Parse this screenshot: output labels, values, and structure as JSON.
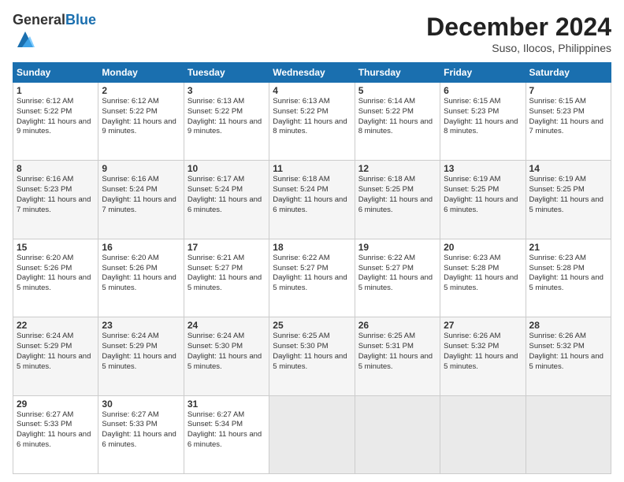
{
  "header": {
    "logo_general": "General",
    "logo_blue": "Blue",
    "month_title": "December 2024",
    "location": "Suso, Ilocos, Philippines"
  },
  "weekdays": [
    "Sunday",
    "Monday",
    "Tuesday",
    "Wednesday",
    "Thursday",
    "Friday",
    "Saturday"
  ],
  "weeks": [
    [
      {
        "day": "1",
        "sunrise": "6:12 AM",
        "sunset": "5:22 PM",
        "daylight": "11 hours and 9 minutes."
      },
      {
        "day": "2",
        "sunrise": "6:12 AM",
        "sunset": "5:22 PM",
        "daylight": "11 hours and 9 minutes."
      },
      {
        "day": "3",
        "sunrise": "6:13 AM",
        "sunset": "5:22 PM",
        "daylight": "11 hours and 9 minutes."
      },
      {
        "day": "4",
        "sunrise": "6:13 AM",
        "sunset": "5:22 PM",
        "daylight": "11 hours and 8 minutes."
      },
      {
        "day": "5",
        "sunrise": "6:14 AM",
        "sunset": "5:22 PM",
        "daylight": "11 hours and 8 minutes."
      },
      {
        "day": "6",
        "sunrise": "6:15 AM",
        "sunset": "5:23 PM",
        "daylight": "11 hours and 8 minutes."
      },
      {
        "day": "7",
        "sunrise": "6:15 AM",
        "sunset": "5:23 PM",
        "daylight": "11 hours and 7 minutes."
      }
    ],
    [
      {
        "day": "8",
        "sunrise": "6:16 AM",
        "sunset": "5:23 PM",
        "daylight": "11 hours and 7 minutes."
      },
      {
        "day": "9",
        "sunrise": "6:16 AM",
        "sunset": "5:24 PM",
        "daylight": "11 hours and 7 minutes."
      },
      {
        "day": "10",
        "sunrise": "6:17 AM",
        "sunset": "5:24 PM",
        "daylight": "11 hours and 6 minutes."
      },
      {
        "day": "11",
        "sunrise": "6:18 AM",
        "sunset": "5:24 PM",
        "daylight": "11 hours and 6 minutes."
      },
      {
        "day": "12",
        "sunrise": "6:18 AM",
        "sunset": "5:25 PM",
        "daylight": "11 hours and 6 minutes."
      },
      {
        "day": "13",
        "sunrise": "6:19 AM",
        "sunset": "5:25 PM",
        "daylight": "11 hours and 6 minutes."
      },
      {
        "day": "14",
        "sunrise": "6:19 AM",
        "sunset": "5:25 PM",
        "daylight": "11 hours and 5 minutes."
      }
    ],
    [
      {
        "day": "15",
        "sunrise": "6:20 AM",
        "sunset": "5:26 PM",
        "daylight": "11 hours and 5 minutes."
      },
      {
        "day": "16",
        "sunrise": "6:20 AM",
        "sunset": "5:26 PM",
        "daylight": "11 hours and 5 minutes."
      },
      {
        "day": "17",
        "sunrise": "6:21 AM",
        "sunset": "5:27 PM",
        "daylight": "11 hours and 5 minutes."
      },
      {
        "day": "18",
        "sunrise": "6:22 AM",
        "sunset": "5:27 PM",
        "daylight": "11 hours and 5 minutes."
      },
      {
        "day": "19",
        "sunrise": "6:22 AM",
        "sunset": "5:27 PM",
        "daylight": "11 hours and 5 minutes."
      },
      {
        "day": "20",
        "sunrise": "6:23 AM",
        "sunset": "5:28 PM",
        "daylight": "11 hours and 5 minutes."
      },
      {
        "day": "21",
        "sunrise": "6:23 AM",
        "sunset": "5:28 PM",
        "daylight": "11 hours and 5 minutes."
      }
    ],
    [
      {
        "day": "22",
        "sunrise": "6:24 AM",
        "sunset": "5:29 PM",
        "daylight": "11 hours and 5 minutes."
      },
      {
        "day": "23",
        "sunrise": "6:24 AM",
        "sunset": "5:29 PM",
        "daylight": "11 hours and 5 minutes."
      },
      {
        "day": "24",
        "sunrise": "6:24 AM",
        "sunset": "5:30 PM",
        "daylight": "11 hours and 5 minutes."
      },
      {
        "day": "25",
        "sunrise": "6:25 AM",
        "sunset": "5:30 PM",
        "daylight": "11 hours and 5 minutes."
      },
      {
        "day": "26",
        "sunrise": "6:25 AM",
        "sunset": "5:31 PM",
        "daylight": "11 hours and 5 minutes."
      },
      {
        "day": "27",
        "sunrise": "6:26 AM",
        "sunset": "5:32 PM",
        "daylight": "11 hours and 5 minutes."
      },
      {
        "day": "28",
        "sunrise": "6:26 AM",
        "sunset": "5:32 PM",
        "daylight": "11 hours and 5 minutes."
      }
    ],
    [
      {
        "day": "29",
        "sunrise": "6:27 AM",
        "sunset": "5:33 PM",
        "daylight": "11 hours and 6 minutes."
      },
      {
        "day": "30",
        "sunrise": "6:27 AM",
        "sunset": "5:33 PM",
        "daylight": "11 hours and 6 minutes."
      },
      {
        "day": "31",
        "sunrise": "6:27 AM",
        "sunset": "5:34 PM",
        "daylight": "11 hours and 6 minutes."
      },
      null,
      null,
      null,
      null
    ]
  ],
  "labels": {
    "sunrise": "Sunrise:",
    "sunset": "Sunset:",
    "daylight": "Daylight:"
  }
}
